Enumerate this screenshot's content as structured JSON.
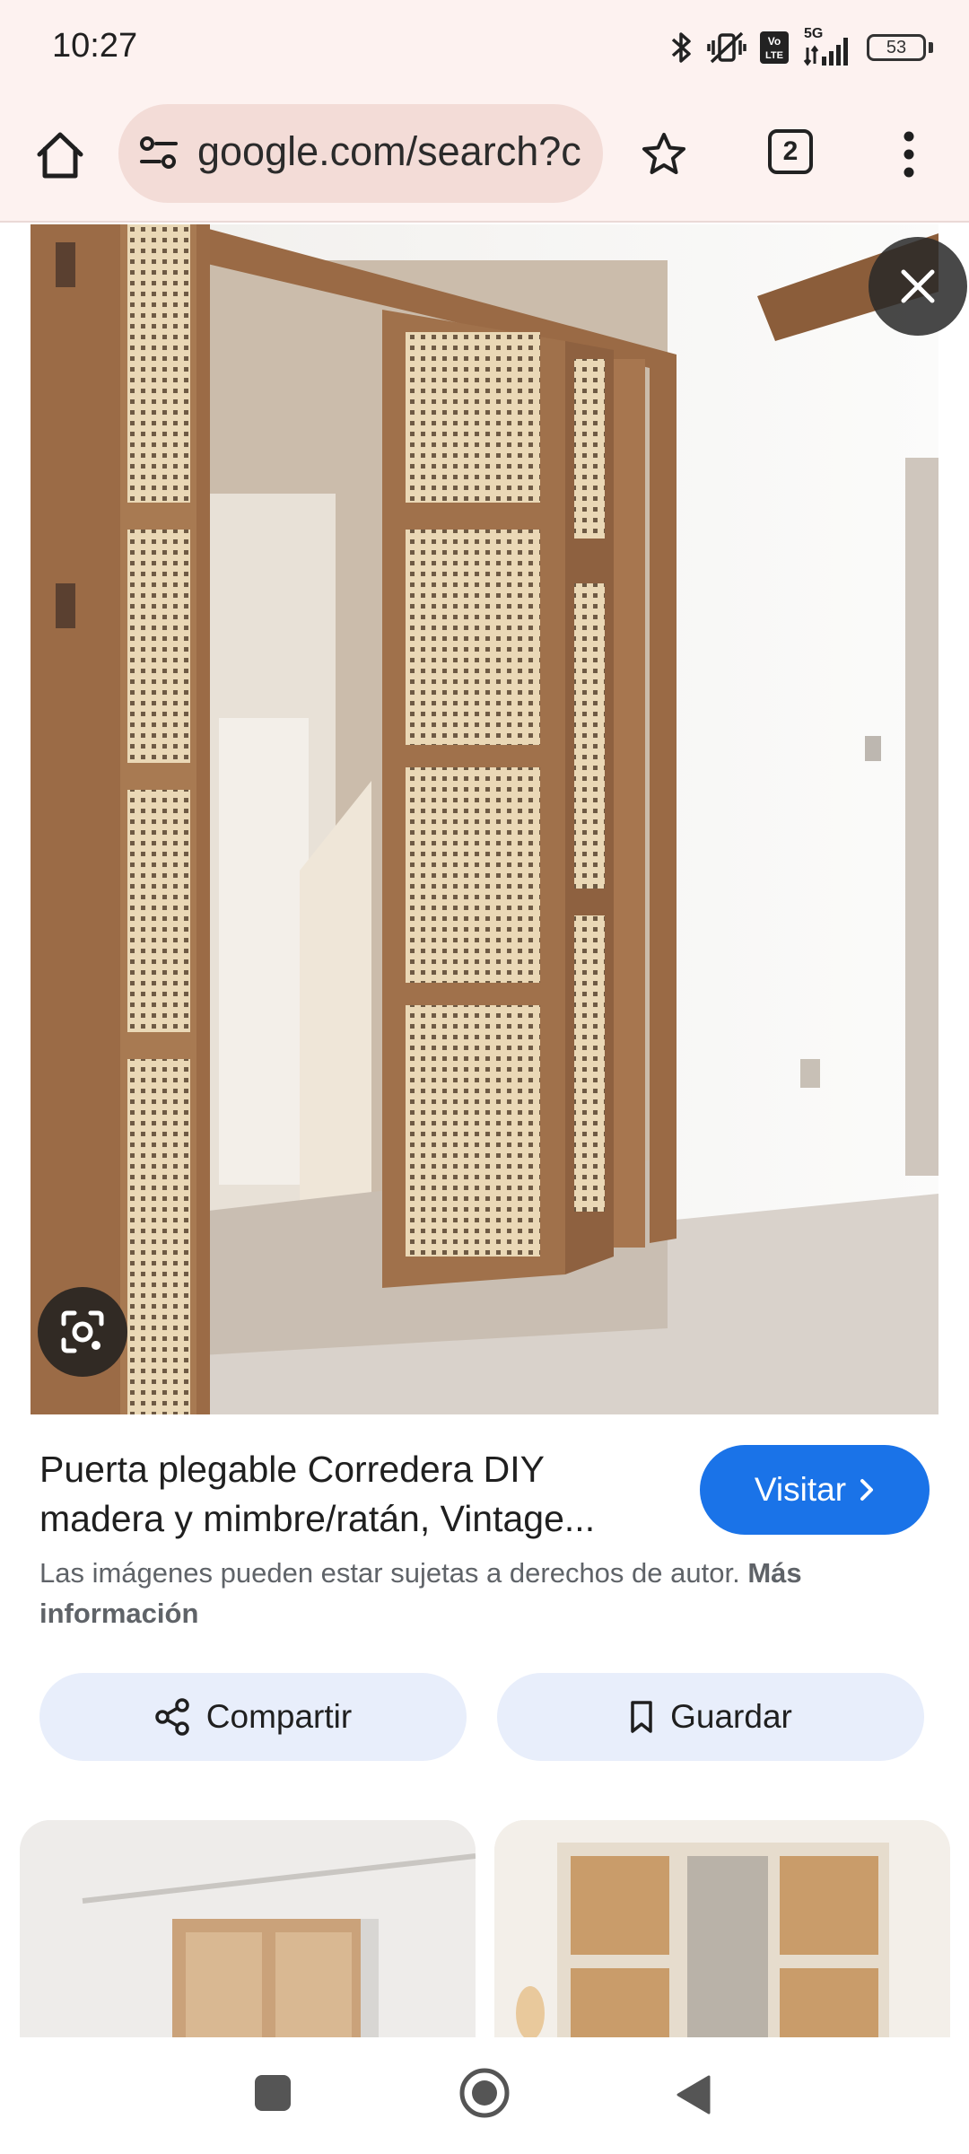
{
  "status_bar": {
    "time": "10:27",
    "network": "5G",
    "volte": "Vo LTE",
    "battery": "53"
  },
  "browser": {
    "url": "google.com/search?c",
    "tab_count": "2"
  },
  "result": {
    "title_line1": "Puerta plegable Corredera DIY",
    "title_line2": "madera y mimbre/ratán, Vintage...",
    "visit_label": "Visitar",
    "copyright_text": "Las imágenes pueden estar sujetas a derechos de autor.",
    "more_info_line1": "Más",
    "more_info_line2": "información"
  },
  "actions": {
    "share_label": "Compartir",
    "save_label": "Guardar"
  },
  "colors": {
    "accent": "#1a73e8",
    "chrome_bg": "#fdf2f0",
    "pill_bg": "#e8eefb"
  }
}
